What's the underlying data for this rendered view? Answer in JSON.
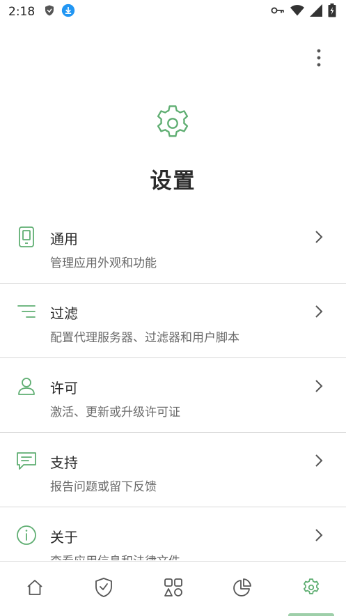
{
  "colors": {
    "accent": "#5fae72",
    "text_primary": "#2a2a2a",
    "text_secondary": "#6a6a6a",
    "divider": "#d8d8d8",
    "nav_icon": "#555555"
  },
  "status_bar": {
    "time": "2:18",
    "icons": [
      "shield-icon",
      "download-icon",
      "vpn-key-icon",
      "wifi-icon",
      "signal-icon",
      "battery-icon"
    ]
  },
  "header": {
    "title": "设置",
    "icon": "gear-icon",
    "menu_icon": "more-vertical-icon"
  },
  "settings": {
    "items": [
      {
        "icon": "phone-icon",
        "title": "通用",
        "subtitle": "管理应用外观和功能"
      },
      {
        "icon": "filter-icon",
        "title": "过滤",
        "subtitle": "配置代理服务器、过滤器和用户脚本"
      },
      {
        "icon": "user-icon",
        "title": "许可",
        "subtitle": "激活、更新或升级许可证"
      },
      {
        "icon": "chat-icon",
        "title": "支持",
        "subtitle": "报告问题或留下反馈"
      },
      {
        "icon": "info-icon",
        "title": "关于",
        "subtitle": "查看应用信息和法律文件"
      }
    ]
  },
  "bottom_nav": {
    "tabs": [
      {
        "icon": "home-icon",
        "selected": false
      },
      {
        "icon": "shield-check-icon",
        "selected": false
      },
      {
        "icon": "apps-icon",
        "selected": false
      },
      {
        "icon": "pie-chart-icon",
        "selected": false
      },
      {
        "icon": "gear-icon",
        "selected": true
      }
    ]
  }
}
